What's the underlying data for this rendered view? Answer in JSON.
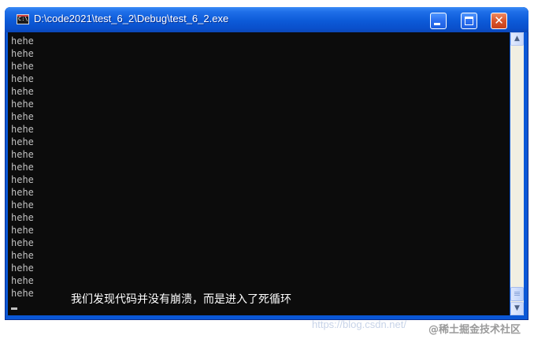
{
  "window": {
    "title": "D:\\code2021\\test_6_2\\Debug\\test_6_2.exe",
    "app_icon_text": "C:\\"
  },
  "console": {
    "lines": [
      "hehe",
      "hehe",
      "hehe",
      "hehe",
      "hehe",
      "hehe",
      "hehe",
      "hehe",
      "hehe",
      "hehe",
      "hehe",
      "hehe",
      "hehe",
      "hehe",
      "hehe",
      "hehe",
      "hehe",
      "hehe",
      "hehe",
      "hehe",
      "hehe"
    ]
  },
  "caption": "我们发现代码并没有崩溃，而是进入了死循环",
  "watermark": {
    "url": "https://blog.csdn.net/",
    "site": "@稀土掘金技术社区"
  },
  "colors": {
    "titlebar": "#0a57d6",
    "console_bg": "#0c0c0c",
    "console_text": "#c0c0c0",
    "close_button": "#d9552b"
  },
  "icons": {
    "minimize": "minimize-icon",
    "maximize": "maximize-icon",
    "close": "close-icon",
    "scroll_up": "arrow-up-icon",
    "scroll_down": "arrow-down-icon"
  }
}
